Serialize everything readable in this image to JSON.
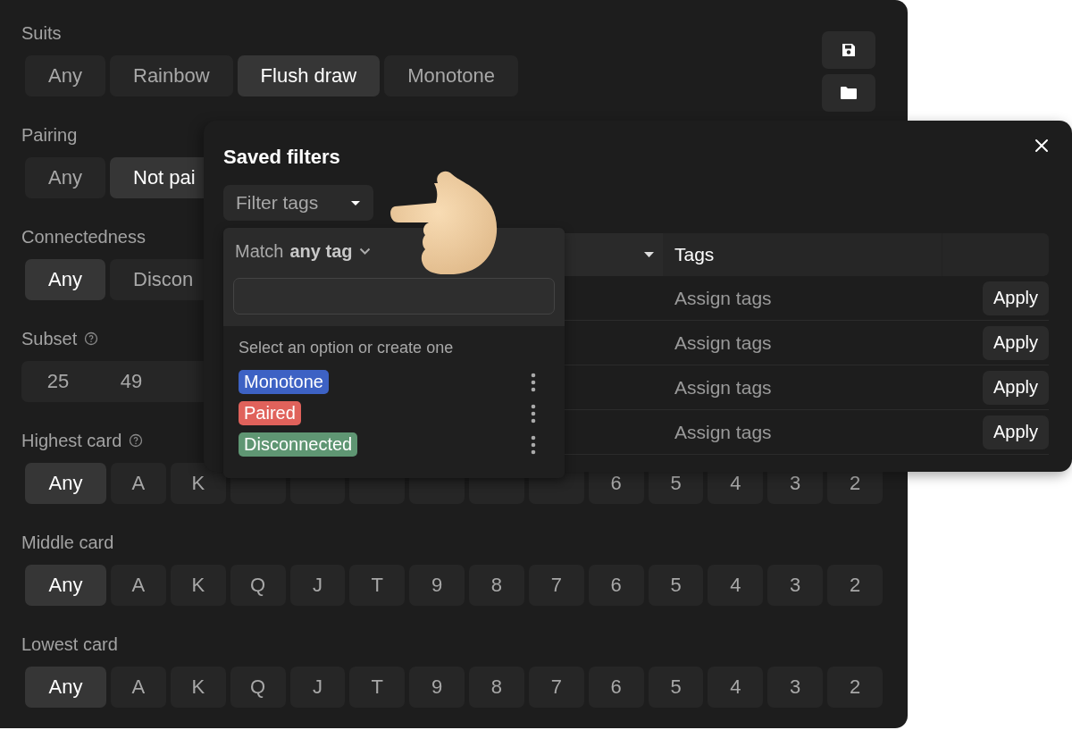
{
  "filter_panel": {
    "sections": [
      {
        "label": "Suits",
        "help": false,
        "kind": "chips",
        "options": [
          {
            "label": "Any",
            "selected": false
          },
          {
            "label": "Rainbow",
            "selected": false
          },
          {
            "label": "Flush draw",
            "selected": true
          },
          {
            "label": "Monotone",
            "selected": false
          }
        ]
      },
      {
        "label": "Pairing",
        "help": false,
        "kind": "chips",
        "options": [
          {
            "label": "Any",
            "selected": false
          },
          {
            "label": "Not pai",
            "selected": true
          }
        ]
      },
      {
        "label": "Connectedness",
        "help": false,
        "kind": "chips",
        "options": [
          {
            "label": "Any",
            "selected": true
          },
          {
            "label": "Discon",
            "selected": false
          }
        ]
      },
      {
        "label": "Subset",
        "help": true,
        "kind": "segmented",
        "options": [
          {
            "label": "25",
            "selected": false
          },
          {
            "label": "49",
            "selected": false
          }
        ]
      },
      {
        "label": "Highest card",
        "help": true,
        "kind": "grid",
        "options": [
          {
            "label": "Any",
            "selected": true
          },
          {
            "label": "A",
            "selected": false
          },
          {
            "label": "K",
            "selected": false
          },
          {
            "selected": false
          },
          {
            "selected": false
          },
          {
            "selected": false
          },
          {
            "selected": false
          },
          {
            "selected": false
          },
          {
            "selected": false
          },
          {
            "label": "6",
            "selected": false
          },
          {
            "label": "5",
            "selected": false
          },
          {
            "label": "4",
            "selected": false
          },
          {
            "label": "3",
            "selected": false
          },
          {
            "label": "2",
            "selected": false
          }
        ]
      },
      {
        "label": "Middle card",
        "help": false,
        "kind": "grid",
        "options": [
          {
            "label": "Any",
            "selected": true
          },
          {
            "label": "A",
            "selected": false
          },
          {
            "label": "K",
            "selected": false
          },
          {
            "label": "Q",
            "selected": false
          },
          {
            "label": "J",
            "selected": false
          },
          {
            "label": "T",
            "selected": false
          },
          {
            "label": "9",
            "selected": false
          },
          {
            "label": "8",
            "selected": false
          },
          {
            "label": "7",
            "selected": false
          },
          {
            "label": "6",
            "selected": false
          },
          {
            "label": "5",
            "selected": false
          },
          {
            "label": "4",
            "selected": false
          },
          {
            "label": "3",
            "selected": false
          },
          {
            "label": "2",
            "selected": false
          }
        ]
      },
      {
        "label": "Lowest card",
        "help": false,
        "kind": "grid",
        "options": [
          {
            "label": "Any",
            "selected": true
          },
          {
            "label": "A",
            "selected": false
          },
          {
            "label": "K",
            "selected": false
          },
          {
            "label": "Q",
            "selected": false
          },
          {
            "label": "J",
            "selected": false
          },
          {
            "label": "T",
            "selected": false
          },
          {
            "label": "9",
            "selected": false
          },
          {
            "label": "8",
            "selected": false
          },
          {
            "label": "7",
            "selected": false
          },
          {
            "label": "6",
            "selected": false
          },
          {
            "label": "5",
            "selected": false
          },
          {
            "label": "4",
            "selected": false
          },
          {
            "label": "3",
            "selected": false
          },
          {
            "label": "2",
            "selected": false
          }
        ]
      }
    ]
  },
  "saved_filters": {
    "title": "Saved filters",
    "filter_tags": "Filter tags",
    "tag_menu": {
      "match": "Match **any tag**",
      "hint": "Select an option or create one",
      "tags": [
        {
          "label": "Monotone",
          "color": "#3d62c4"
        },
        {
          "label": "Paired",
          "color": "#e0625b"
        },
        {
          "label": "Disconnected",
          "color": "#5f9673"
        }
      ]
    },
    "table": {
      "columns": [
        "Tags"
      ],
      "rows": [
        {
          "tags": "Assign tags",
          "action": "Apply"
        },
        {
          "tags": "Assign tags",
          "action": "Apply"
        },
        {
          "tags": "Assign tags",
          "action": "Apply"
        },
        {
          "tags": "Assign tags",
          "action": "Apply"
        }
      ]
    }
  }
}
